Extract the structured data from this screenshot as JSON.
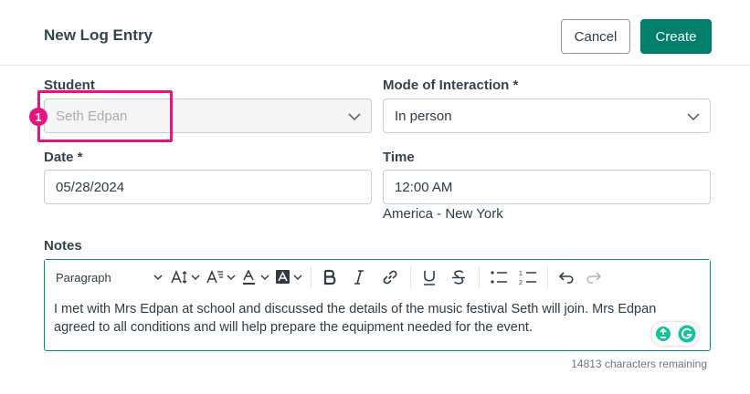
{
  "header": {
    "title": "New Log Entry",
    "cancel_label": "Cancel",
    "create_label": "Create"
  },
  "form": {
    "student": {
      "label": "Student",
      "value": "Seth Edpan"
    },
    "mode": {
      "label": "Mode of Interaction *",
      "value": "In person"
    },
    "date": {
      "label": "Date *",
      "value": "05/28/2024"
    },
    "time": {
      "label": "Time",
      "value": "12:00 AM",
      "timezone": "America - New York"
    },
    "notes": {
      "label": "Notes",
      "paragraph_style": "Paragraph",
      "text": "I met with Mrs Edpan at school and discussed the details of the music festival Seth will join. Mrs Edpan agreed to all conditions and will help prepare the equipment needed for the event.",
      "chars_remaining": "14813 characters remaining"
    }
  },
  "annotation": {
    "badge": "1",
    "color": "#e8137f"
  },
  "colors": {
    "primary": "#00806b",
    "highlight": "#e8137f"
  }
}
